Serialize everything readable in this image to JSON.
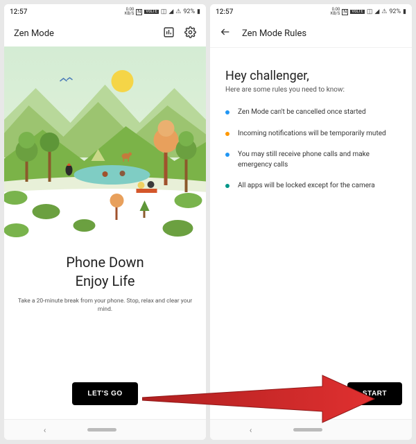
{
  "status": {
    "time": "12:57",
    "net_speed_top": "0.00",
    "net_speed_bot": "KB/S",
    "nfc": "N",
    "volte": "VoLTE",
    "battery_pct": "92%"
  },
  "left": {
    "app_title": "Zen Mode",
    "headline_line1": "Phone Down",
    "headline_line2": "Enjoy Life",
    "subtitle": "Take a 20-minute break from your phone. Stop, relax and clear your mind.",
    "button": "LET'S GO"
  },
  "right": {
    "screen_title": "Zen Mode Rules",
    "heading": "Hey challenger,",
    "subheading": "Here are some rules you need to know:",
    "rules": [
      {
        "color": "#2196f3",
        "text": "Zen Mode can't be cancelled once started"
      },
      {
        "color": "#ff9800",
        "text": "Incoming notifications will be temporarily muted"
      },
      {
        "color": "#2196f3",
        "text": "You may still receive phone calls and make emergency calls"
      },
      {
        "color": "#009688",
        "text": "All apps will be locked except for the camera"
      }
    ],
    "button": "START"
  }
}
